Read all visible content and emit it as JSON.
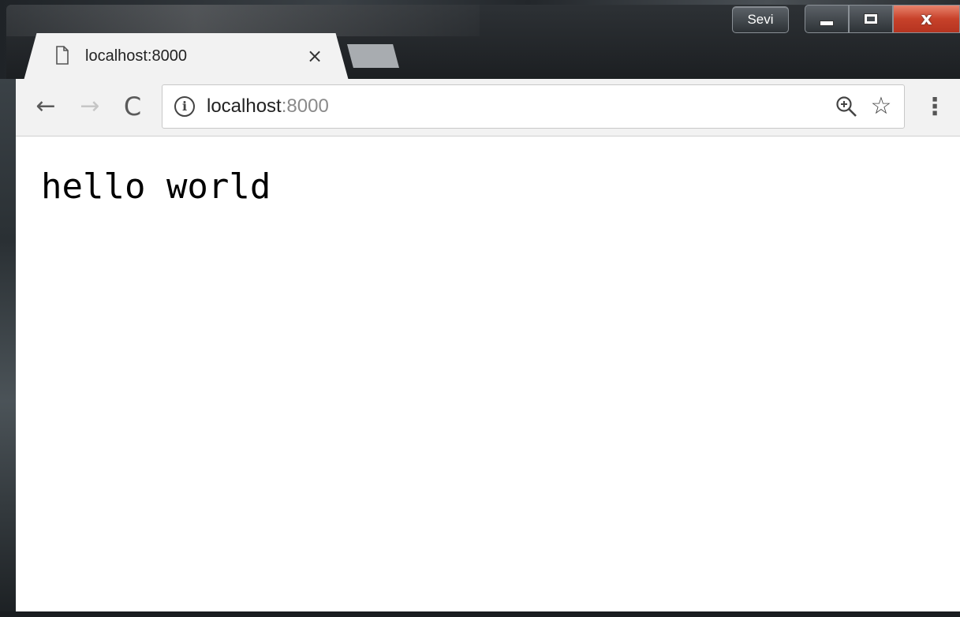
{
  "window": {
    "user_badge": "Sevi",
    "controls": {
      "close_glyph": "x"
    }
  },
  "tab": {
    "title": "localhost:8000",
    "favicon": "page-icon",
    "close_glyph": "×"
  },
  "toolbar": {
    "back_glyph": "←",
    "forward_glyph": "→",
    "reload_glyph": "C",
    "info_glyph": "i",
    "url_host": "localhost",
    "url_port": ":8000",
    "star_glyph": "☆",
    "menu_glyph": "⋮"
  },
  "page": {
    "text": "hello world"
  },
  "colors": {
    "close_button": "#c7412a",
    "url_port": "#8a8a8a",
    "tab_background": "#f2f2f2"
  }
}
